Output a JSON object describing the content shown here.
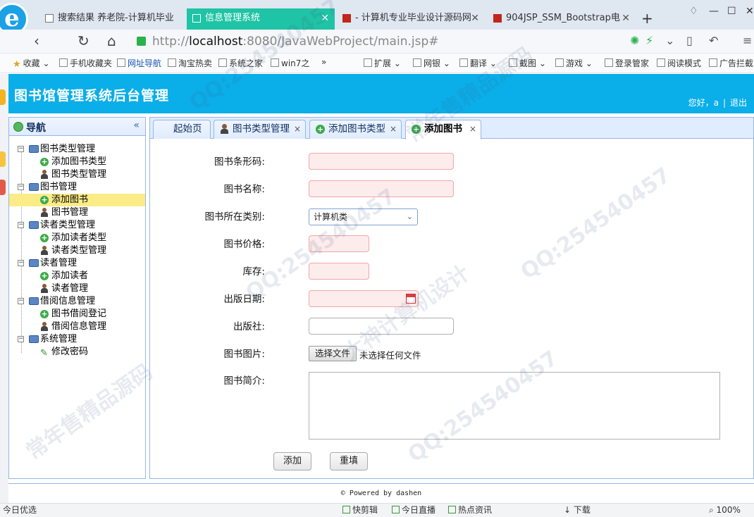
{
  "browser": {
    "tabs": [
      {
        "label": "搜索结果 养老院-计算机毕业",
        "icon": "doc-icon",
        "active": false
      },
      {
        "label": "信息管理系统",
        "icon": "doc-icon",
        "active": true
      },
      {
        "label": "- 计算机专业毕业设计源码网",
        "icon": "site-icon",
        "active": false
      },
      {
        "label": "904JSP_SSM_Bootstrap电",
        "icon": "site-icon",
        "active": false
      }
    ],
    "new_tab": "+",
    "url_prefix": "http://",
    "url_host": "localhost",
    "url_rest": ":8080/JavaWebProject/main.jsp#",
    "bookmarks": [
      {
        "label": "收藏",
        "icon": "star-icon"
      },
      {
        "label": "手机收藏夹",
        "icon": "phone-icon"
      },
      {
        "label": "网址导航",
        "icon": "doc-icon"
      },
      {
        "label": "淘宝热卖",
        "icon": "doc-icon"
      },
      {
        "label": "系统之家",
        "icon": "doc-icon"
      },
      {
        "label": "win7之",
        "icon": "doc-icon"
      },
      {
        "label": "»",
        "icon": ""
      },
      {
        "label": "扩展",
        "icon": "grid-icon"
      },
      {
        "label": "网银",
        "icon": "globe-icon"
      },
      {
        "label": "翻译",
        "icon": "translate-icon"
      },
      {
        "label": "截图",
        "icon": "scissors-icon"
      },
      {
        "label": "游戏",
        "icon": "gamepad-icon"
      },
      {
        "label": "登录管家",
        "icon": "key-icon"
      },
      {
        "label": "阅读模式",
        "icon": "book-icon"
      },
      {
        "label": "广告拦截",
        "icon": "block-icon"
      }
    ]
  },
  "app": {
    "title": "图书馆管理系统后台管理",
    "greeting": "您好，a",
    "separator": "|",
    "logout": "退出"
  },
  "nav": {
    "title": "导航",
    "collapse": "«",
    "groups": [
      {
        "label": "图书类型管理",
        "items": [
          {
            "label": "添加图书类型",
            "icon": "add-icon"
          },
          {
            "label": "图书类型管理",
            "icon": "user-icon"
          }
        ]
      },
      {
        "label": "图书管理",
        "items": [
          {
            "label": "添加图书",
            "icon": "add-icon",
            "selected": true
          },
          {
            "label": "图书管理",
            "icon": "user-icon"
          }
        ]
      },
      {
        "label": "读者类型管理",
        "items": [
          {
            "label": "添加读者类型",
            "icon": "add-icon"
          },
          {
            "label": "读者类型管理",
            "icon": "user-icon"
          }
        ]
      },
      {
        "label": "读者管理",
        "items": [
          {
            "label": "添加读者",
            "icon": "add-icon"
          },
          {
            "label": "读者管理",
            "icon": "user-icon"
          }
        ]
      },
      {
        "label": "借阅信息管理",
        "items": [
          {
            "label": "图书借阅登记",
            "icon": "add-icon"
          },
          {
            "label": "借阅信息管理",
            "icon": "user-icon"
          }
        ]
      },
      {
        "label": "系统管理",
        "items": [
          {
            "label": "修改密码",
            "icon": "pencil-icon"
          }
        ]
      }
    ]
  },
  "tabs": [
    {
      "label": "起始页",
      "icon": "",
      "closable": false
    },
    {
      "label": "图书类型管理",
      "icon": "user-icon",
      "closable": true
    },
    {
      "label": "添加图书类型",
      "icon": "add-icon",
      "closable": true
    },
    {
      "label": "添加图书",
      "icon": "add-icon",
      "closable": true,
      "active": true
    }
  ],
  "form": {
    "barcode": {
      "label": "图书条形码:",
      "value": ""
    },
    "name": {
      "label": "图书名称:",
      "value": ""
    },
    "category": {
      "label": "图书所在类别:",
      "value": "计算机类"
    },
    "price": {
      "label": "图书价格:",
      "value": ""
    },
    "stock": {
      "label": "库存:",
      "value": ""
    },
    "publish_date": {
      "label": "出版日期:",
      "value": ""
    },
    "publisher": {
      "label": "出版社:",
      "value": ""
    },
    "photo": {
      "label": "图书图片:",
      "button": "选择文件",
      "status": "未选择任何文件"
    },
    "intro": {
      "label": "图书简介:",
      "value": ""
    },
    "submit": "添加",
    "reset": "重填"
  },
  "footer": {
    "text": "Powered by dashen",
    "icon": "copyright-icon"
  },
  "statusbar": {
    "left": "今日优选",
    "items": [
      "快剪辑",
      "今日直播",
      "热点资讯",
      "下载"
    ],
    "zoom": "100%"
  },
  "watermark": {
    "lines": [
      "QQ:254540457",
      "大神计算机设计",
      "常年售精品源码"
    ]
  }
}
